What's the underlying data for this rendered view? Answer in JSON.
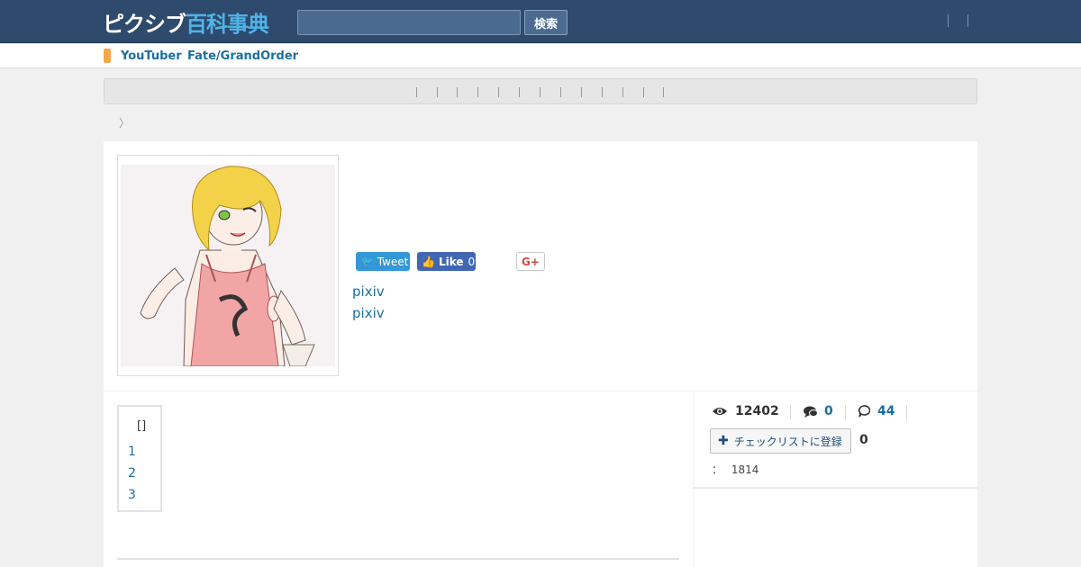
{
  "header": {
    "logo_part1": "ピクシブ",
    "logo_part2": "百科事典",
    "search_value": "",
    "search_button": "検索"
  },
  "tagbar": {
    "tags": [
      "YouTuber",
      "Fate/GrandOrder"
    ]
  },
  "breadcrumb": {
    "separator": "〉"
  },
  "article": {
    "share": {
      "tweet": "Tweet",
      "like": "Like",
      "like_count": "0",
      "gplus": "G+"
    },
    "links": [
      "pixiv",
      "pixiv"
    ]
  },
  "toc": {
    "title": "[]",
    "items": [
      "1",
      "2",
      "3"
    ]
  },
  "stats": {
    "views": "12402",
    "comments": "0",
    "bubbles": "44"
  },
  "checklist": {
    "label": "チェックリストに登録",
    "count": "0"
  },
  "meta": {
    "label": "：",
    "value": "1814"
  },
  "colors": {
    "header_bg": "#2e4a6c",
    "link": "#1a6fa0",
    "tag_marker": "#f5a74a",
    "tweet": "#3498d8",
    "like": "#4267b2"
  }
}
